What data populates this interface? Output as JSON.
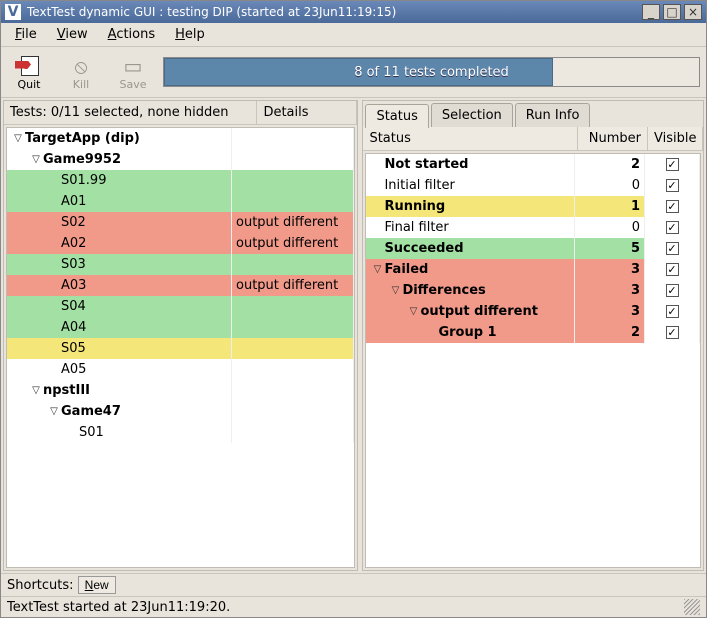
{
  "window": {
    "title": "TextTest dynamic GUI : testing DIP (started at 23Jun11:19:15)",
    "buttons": {
      "minimize": "_",
      "maximize": "□",
      "close": "×"
    }
  },
  "menubar": {
    "file": "File",
    "view": "View",
    "actions": "Actions",
    "help": "Help"
  },
  "toolbar": {
    "quit": "Quit",
    "kill": "Kill",
    "save": "Save"
  },
  "progress": {
    "text": "8 of 11 tests completed",
    "completed": 8,
    "total": 11
  },
  "left": {
    "header": {
      "tests": "Tests: 0/11 selected, none hidden",
      "details": "Details"
    },
    "rows": [
      {
        "indent": 0,
        "expander": "▽",
        "name": "TargetApp (dip)",
        "detail": "",
        "style": "bold",
        "bg": ""
      },
      {
        "indent": 1,
        "expander": "▽",
        "name": "Game9952",
        "detail": "",
        "style": "bold",
        "bg": ""
      },
      {
        "indent": 2,
        "expander": "",
        "name": "S01.99",
        "detail": "",
        "style": "",
        "bg": "green"
      },
      {
        "indent": 2,
        "expander": "",
        "name": "A01",
        "detail": "",
        "style": "",
        "bg": "green"
      },
      {
        "indent": 2,
        "expander": "",
        "name": "S02",
        "detail": "output different",
        "style": "",
        "bg": "red"
      },
      {
        "indent": 2,
        "expander": "",
        "name": "A02",
        "detail": "output different",
        "style": "",
        "bg": "red"
      },
      {
        "indent": 2,
        "expander": "",
        "name": "S03",
        "detail": "",
        "style": "",
        "bg": "green"
      },
      {
        "indent": 2,
        "expander": "",
        "name": "A03",
        "detail": "output different",
        "style": "",
        "bg": "red"
      },
      {
        "indent": 2,
        "expander": "",
        "name": "S04",
        "detail": "",
        "style": "",
        "bg": "green"
      },
      {
        "indent": 2,
        "expander": "",
        "name": "A04",
        "detail": "",
        "style": "",
        "bg": "green"
      },
      {
        "indent": 2,
        "expander": "",
        "name": "S05",
        "detail": "",
        "style": "",
        "bg": "yellow"
      },
      {
        "indent": 2,
        "expander": "",
        "name": "A05",
        "detail": "",
        "style": "",
        "bg": ""
      },
      {
        "indent": 1,
        "expander": "▽",
        "name": "npstIII",
        "detail": "",
        "style": "bold",
        "bg": ""
      },
      {
        "indent": 2,
        "expander": "▽",
        "name": "Game47",
        "detail": "",
        "style": "bold",
        "bg": ""
      },
      {
        "indent": 3,
        "expander": "",
        "name": "S01",
        "detail": "",
        "style": "",
        "bg": ""
      }
    ]
  },
  "right": {
    "tabs": {
      "status": "Status",
      "selection": "Selection",
      "runinfo": "Run Info"
    },
    "headers": {
      "status": "Status",
      "number": "Number",
      "visible": "Visible"
    },
    "rows": [
      {
        "indent": 0,
        "expander": "",
        "name": "Not started",
        "number": "2",
        "checked": true,
        "style": "bold",
        "bg": ""
      },
      {
        "indent": 0,
        "expander": "",
        "name": "Initial filter",
        "number": "0",
        "checked": true,
        "style": "",
        "bg": ""
      },
      {
        "indent": 0,
        "expander": "",
        "name": "Running",
        "number": "1",
        "checked": true,
        "style": "bold",
        "bg": "yellow"
      },
      {
        "indent": 0,
        "expander": "",
        "name": "Final filter",
        "number": "0",
        "checked": true,
        "style": "",
        "bg": ""
      },
      {
        "indent": 0,
        "expander": "",
        "name": "Succeeded",
        "number": "5",
        "checked": true,
        "style": "bold",
        "bg": "green"
      },
      {
        "indent": 0,
        "expander": "▽",
        "name": "Failed",
        "number": "3",
        "checked": true,
        "style": "bold",
        "bg": "red"
      },
      {
        "indent": 1,
        "expander": "▽",
        "name": "Differences",
        "number": "3",
        "checked": true,
        "style": "bold",
        "bg": "red"
      },
      {
        "indent": 2,
        "expander": "▽",
        "name": "output different",
        "number": "3",
        "checked": true,
        "style": "bold",
        "bg": "red"
      },
      {
        "indent": 3,
        "expander": "",
        "name": "Group 1",
        "number": "2",
        "checked": true,
        "style": "bold",
        "bg": "red"
      }
    ]
  },
  "footer": {
    "shortcuts": "Shortcuts:",
    "new": "New",
    "status": "TextTest started at 23Jun11:19:20."
  }
}
